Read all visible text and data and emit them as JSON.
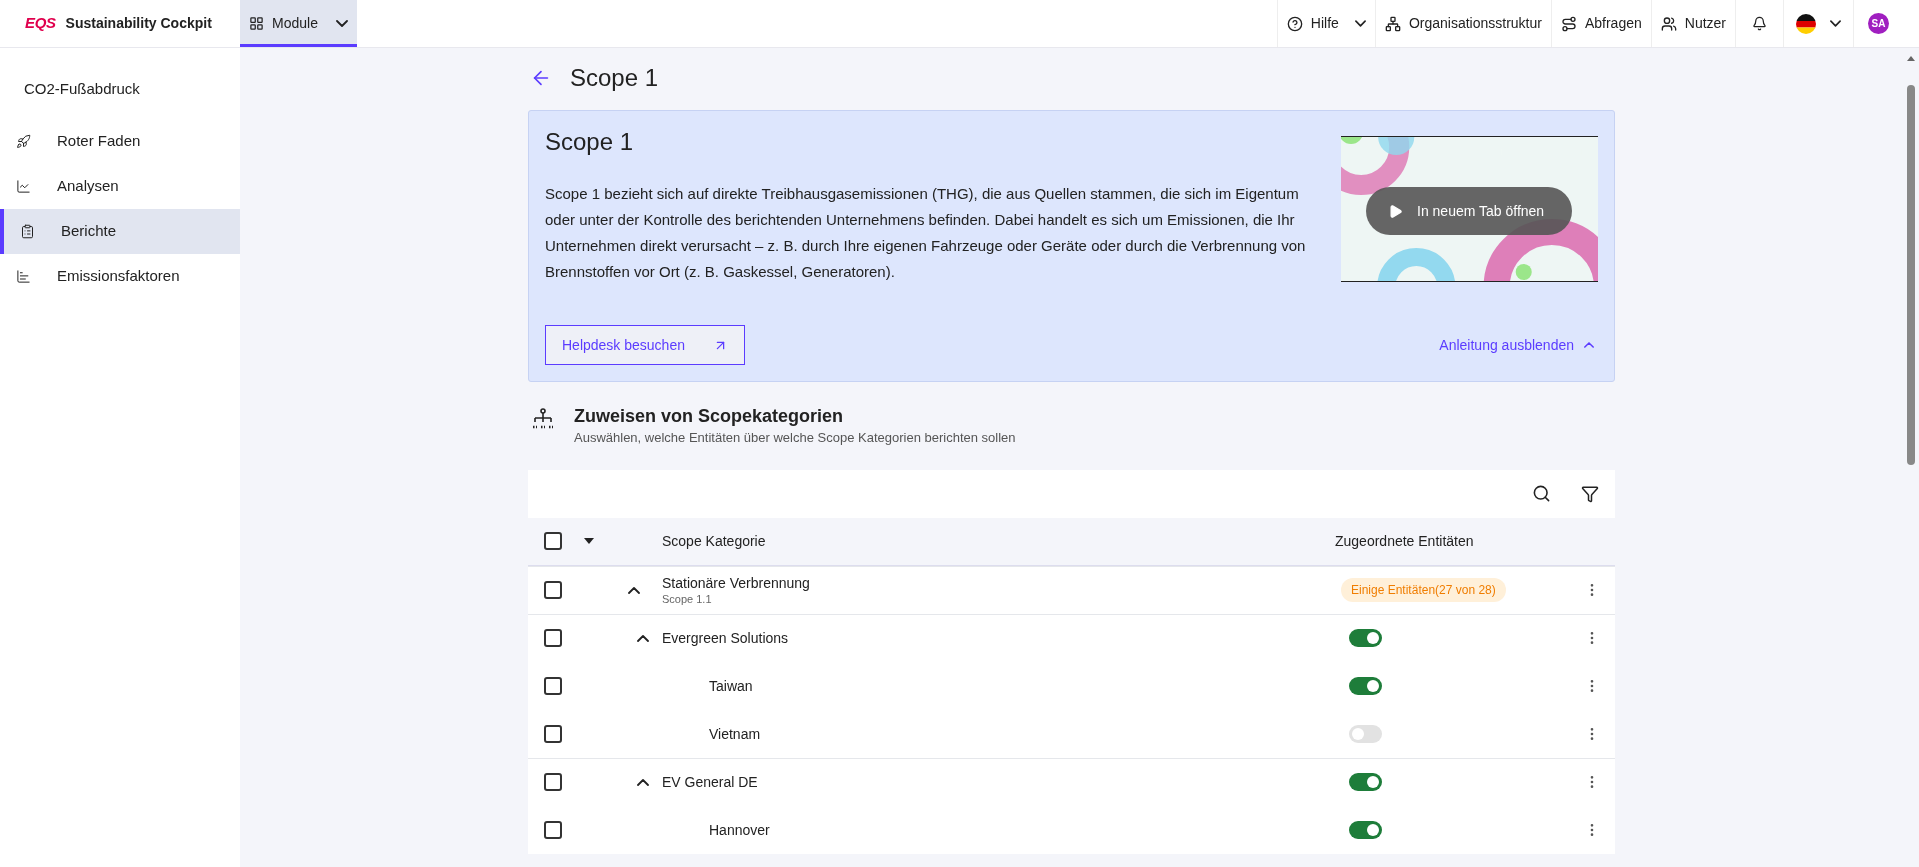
{
  "topbar": {
    "brand": "Sustainability Cockpit",
    "logo": "EQS",
    "module_menu": {
      "label": "Module",
      "selected": true
    },
    "items": [
      {
        "kind": "dropdown",
        "label": "Hilfe"
      },
      {
        "kind": "link",
        "label": "Organisationsstruktur"
      },
      {
        "kind": "link",
        "label": "Abfragen"
      },
      {
        "kind": "link",
        "label": "Nutzer"
      }
    ],
    "avatar": "SA"
  },
  "sidebar": {
    "title": "CO2-Fußabdruck",
    "items": [
      {
        "label": "Roter Faden",
        "selected": false
      },
      {
        "label": "Analysen",
        "selected": false
      },
      {
        "label": "Berichte",
        "selected": true
      },
      {
        "label": "Emissionsfaktoren",
        "selected": false
      }
    ]
  },
  "page": {
    "title": "Scope 1"
  },
  "intro": {
    "title": "Scope 1",
    "text": "Scope 1 bezieht sich auf direkte Treibhausgasemissionen (THG), die aus Quellen stammen, die sich im Eigentum oder unter der Kontrolle des berichtenden Unternehmens befinden. Dabei handelt es sich um Emissionen, die Ihr Unternehmen direkt verursacht – z. B. durch Ihre eigenen Fahrzeuge oder Geräte oder durch die Verbrennung von Brennstoffen vor Ort (z. B. Gaskessel, Generatoren).",
    "video": {
      "kind": "picture",
      "button": "In neuem Tab öffnen"
    },
    "helpdesk_button": "Helpdesk besuchen",
    "hide_link": "Anleitung ausblenden"
  },
  "section": {
    "title": "Zuweisen von Scopekategorien",
    "subtitle": "Auswählen, welche Entitäten über welche Scope Kategorien berichten sollen"
  },
  "table": {
    "columns": [
      "Scope Kategorie",
      "Zugeordnete Entitäten"
    ],
    "select_all": {
      "checked": false
    },
    "rows": [
      {
        "kind": "category",
        "name": "Stationäre Verbrennung",
        "sub": "Scope 1.1",
        "badge": "Einige Entitäten(27 von 28)",
        "checked": false,
        "expanded": true,
        "children": [
          {
            "kind": "entity",
            "name": "Evergreen Solutions",
            "checked": false,
            "expanded": true,
            "on": true,
            "children": [
              {
                "kind": "entity",
                "name": "Taiwan",
                "checked": false,
                "on": true
              },
              {
                "kind": "entity",
                "name": "Vietnam",
                "checked": false,
                "on": false
              }
            ]
          },
          {
            "kind": "entity",
            "name": "EV General DE",
            "checked": false,
            "expanded": true,
            "on": true,
            "children": [
              {
                "kind": "entity",
                "name": "Hannover",
                "checked": false,
                "on": true
              }
            ]
          }
        ]
      }
    ]
  }
}
